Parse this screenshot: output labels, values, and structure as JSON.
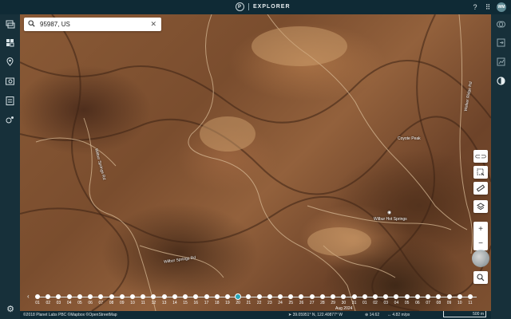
{
  "app": {
    "title": "EXPLORER",
    "logo_letter": "P",
    "user_initials": "WM"
  },
  "search": {
    "value": "95987, US",
    "placeholder": "Search"
  },
  "map_labels": {
    "peak": "Coyote Peak",
    "springs": "Wilbur Hot Springs",
    "road1": "Wilbur Springs Rd",
    "road2": "Walker Ridge Rd",
    "road3": "Wilbur Springs Rd"
  },
  "timeline": {
    "days": [
      "01",
      "02",
      "03",
      "04",
      "05",
      "06",
      "07",
      "08",
      "09",
      "10",
      "11",
      "12",
      "13",
      "14",
      "15",
      "16",
      "17",
      "18",
      "19",
      "20",
      "21",
      "22",
      "23",
      "24",
      "25",
      "26",
      "27",
      "28",
      "29",
      "30",
      "31",
      "01",
      "02",
      "03",
      "04",
      "05",
      "06",
      "07",
      "08",
      "09",
      "10",
      "11"
    ],
    "selected": "20",
    "month_label": "Aug 2024"
  },
  "footer": {
    "attribution": "©2018 Planet Labs PBC ©Mapbox ©OpenStreetMap",
    "coords": "39.05951° N, 122.40877° W",
    "zoom": "14.62",
    "resolution": "4.82 m/px",
    "scale": "500 m"
  },
  "icons": {
    "left": [
      "layers-panel-icon",
      "mosaic-icon",
      "places-icon",
      "image-search-icon",
      "tasks-icon",
      "analytics-icon"
    ],
    "right": [
      "compare-icon",
      "export-icon",
      "stats-icon",
      "contrast-icon"
    ]
  }
}
